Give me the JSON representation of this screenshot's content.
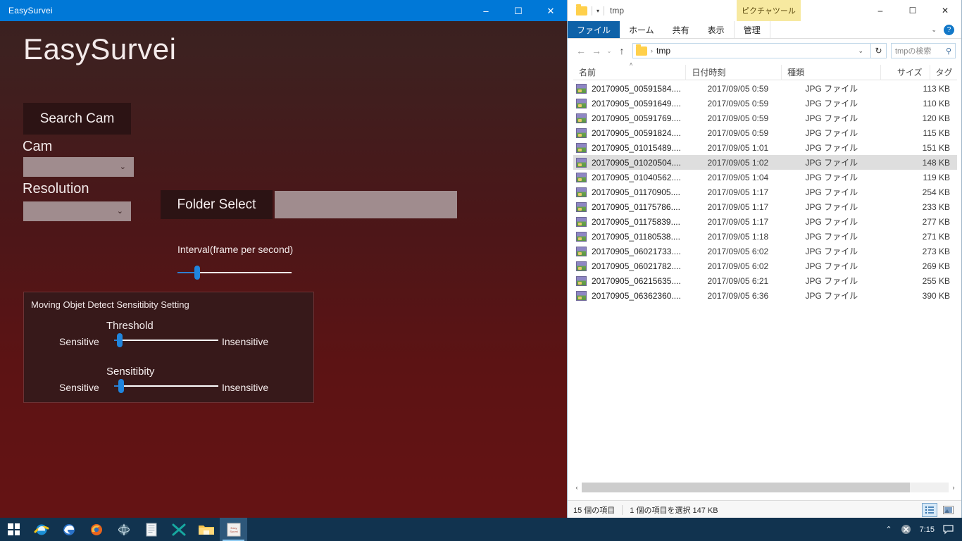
{
  "app": {
    "titlebar": {
      "title": "EasySurvei",
      "minimize": "–",
      "maximize": "☐",
      "close": "✕"
    },
    "heading": "EasySurvei",
    "search_cam_button": "Search Cam",
    "cam_label": "Cam",
    "cam_value": "",
    "resolution_label": "Resolution",
    "resolution_value": "",
    "combo_chevron": "⌄",
    "folder_select_button": "Folder Select",
    "folder_path_value": "",
    "interval_label": "Interval(frame per second)",
    "sensitivity_group": {
      "title": "Moving Objet Detect Sensitibity Setting",
      "threshold": {
        "title": "Threshold",
        "min_label": "Sensitive",
        "max_label": "Insensitive"
      },
      "sensitibity": {
        "title": "Sensitibity",
        "min_label": "Sensitive",
        "max_label": "Insensitive"
      }
    },
    "colors": {
      "titlebar": "#0078d7",
      "background_top": "#38201f",
      "background_bottom": "#651314",
      "control_fill": "#a08c8e",
      "button_fill": "#2c1314",
      "slider_accent": "#1f85de"
    }
  },
  "explorer": {
    "titlebar": {
      "title": "tmp",
      "quick_access_chevron": "▾",
      "picture_tools_tab": "ピクチャツール",
      "minimize": "–",
      "maximize": "☐",
      "close": "✕"
    },
    "ribbon_tabs": [
      {
        "label": "ファイル",
        "type": "file"
      },
      {
        "label": "ホーム",
        "type": "normal"
      },
      {
        "label": "共有",
        "type": "normal"
      },
      {
        "label": "表示",
        "type": "normal"
      },
      {
        "label": "管理",
        "type": "contextual"
      }
    ],
    "ribbon_collapse_chevron": "⌄",
    "help_label": "?",
    "address": {
      "back": "←",
      "forward": "→",
      "history": "⌄",
      "up": "↑",
      "crumb": "tmp",
      "separator": "›",
      "dropdown": "⌄",
      "refresh": "↻",
      "search_placeholder": "tmpの検索",
      "search_icon": "⚲"
    },
    "columns": [
      {
        "label": "名前",
        "key": "name"
      },
      {
        "label": "日付時刻",
        "key": "date"
      },
      {
        "label": "種類",
        "key": "type"
      },
      {
        "label": "サイズ",
        "key": "size"
      },
      {
        "label": "タグ",
        "key": "tag"
      }
    ],
    "sort_indicator": "˄",
    "files": [
      {
        "name": "20170905_00591584....",
        "date": "2017/09/05 0:59",
        "type": "JPG ファイル",
        "size": "113 KB",
        "selected": false
      },
      {
        "name": "20170905_00591649....",
        "date": "2017/09/05 0:59",
        "type": "JPG ファイル",
        "size": "110 KB",
        "selected": false
      },
      {
        "name": "20170905_00591769....",
        "date": "2017/09/05 0:59",
        "type": "JPG ファイル",
        "size": "120 KB",
        "selected": false
      },
      {
        "name": "20170905_00591824....",
        "date": "2017/09/05 0:59",
        "type": "JPG ファイル",
        "size": "115 KB",
        "selected": false
      },
      {
        "name": "20170905_01015489....",
        "date": "2017/09/05 1:01",
        "type": "JPG ファイル",
        "size": "151 KB",
        "selected": false
      },
      {
        "name": "20170905_01020504....",
        "date": "2017/09/05 1:02",
        "type": "JPG ファイル",
        "size": "148 KB",
        "selected": true
      },
      {
        "name": "20170905_01040562....",
        "date": "2017/09/05 1:04",
        "type": "JPG ファイル",
        "size": "119 KB",
        "selected": false
      },
      {
        "name": "20170905_01170905....",
        "date": "2017/09/05 1:17",
        "type": "JPG ファイル",
        "size": "254 KB",
        "selected": false
      },
      {
        "name": "20170905_01175786....",
        "date": "2017/09/05 1:17",
        "type": "JPG ファイル",
        "size": "233 KB",
        "selected": false
      },
      {
        "name": "20170905_01175839....",
        "date": "2017/09/05 1:17",
        "type": "JPG ファイル",
        "size": "277 KB",
        "selected": false
      },
      {
        "name": "20170905_01180538....",
        "date": "2017/09/05 1:18",
        "type": "JPG ファイル",
        "size": "271 KB",
        "selected": false
      },
      {
        "name": "20170905_06021733....",
        "date": "2017/09/05 6:02",
        "type": "JPG ファイル",
        "size": "273 KB",
        "selected": false
      },
      {
        "name": "20170905_06021782....",
        "date": "2017/09/05 6:02",
        "type": "JPG ファイル",
        "size": "269 KB",
        "selected": false
      },
      {
        "name": "20170905_06215635....",
        "date": "2017/09/05 6:21",
        "type": "JPG ファイル",
        "size": "255 KB",
        "selected": false
      },
      {
        "name": "20170905_06362360....",
        "date": "2017/09/05 6:36",
        "type": "JPG ファイル",
        "size": "390 KB",
        "selected": false
      }
    ],
    "scrollbar": {
      "left_arrow": "‹",
      "right_arrow": "›"
    },
    "status": {
      "item_count": "15 個の項目",
      "selection": "1 個の項目を選択  147 KB"
    }
  },
  "taskbar": {
    "items": [
      {
        "name": "start-button",
        "label": ""
      },
      {
        "name": "internet-explorer",
        "label": ""
      },
      {
        "name": "microsoft-edge",
        "label": ""
      },
      {
        "name": "firefox",
        "label": ""
      },
      {
        "name": "browser-app",
        "label": ""
      },
      {
        "name": "notepad",
        "label": ""
      },
      {
        "name": "xming-app",
        "label": ""
      },
      {
        "name": "file-explorer",
        "label": ""
      },
      {
        "name": "easysurvei-app",
        "label": ""
      }
    ],
    "tray": {
      "show_hidden": "⌃",
      "clock": "7:15"
    }
  }
}
